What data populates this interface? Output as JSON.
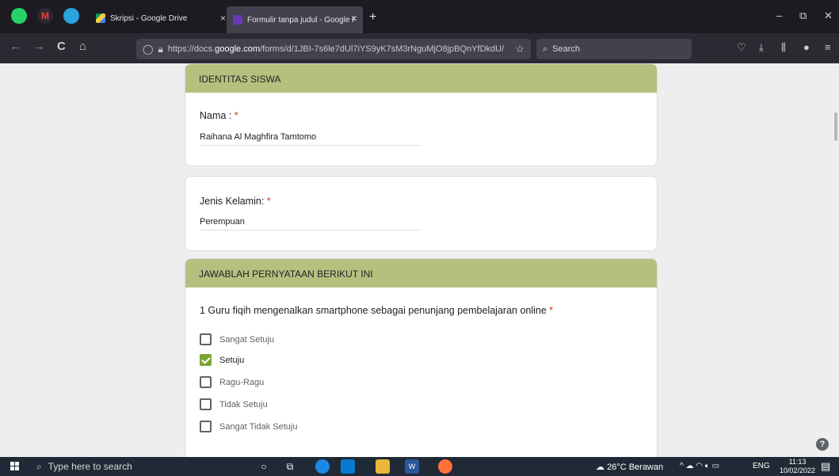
{
  "browser": {
    "tabs": [
      {
        "label": "Skripsi - Google Drive",
        "close": "×"
      },
      {
        "label": "Formulir tanpa judul - Google F",
        "close": "×"
      }
    ],
    "new_tab": "+",
    "window_controls": {
      "minimize": "–",
      "maximize": "⧉",
      "close": "✕"
    },
    "nav": {
      "back": "←",
      "forward": "→",
      "reload": "C",
      "home": "⌂"
    },
    "url_prefix": "https://docs.",
    "url_domain": "google.com",
    "url_rest": "/forms/d/1JBI-7s6le7dUl7iYS9yK7sM3rNguMjO8jpBQnYfDkdU/",
    "search_placeholder": "Search",
    "accent_colors": {
      "tab_strip": "#1c1b22",
      "toolbar": "#2b2a33",
      "section_header": "#b5c07f",
      "checkbox_checked": "#7aa52f"
    }
  },
  "form": {
    "section1": {
      "title": "IDENTITAS SISWA",
      "q_nama": {
        "label": "Nama :",
        "required": "*",
        "value": "Raihana Al Maghfira Tamtomo"
      }
    },
    "q_gender": {
      "label": "Jenis Kelamin:",
      "required": "*",
      "value": "Perempuan"
    },
    "section2": {
      "title": "JAWABLAH PERNYATAAN BERIKUT INI",
      "q1": {
        "label": "1 Guru fiqih mengenalkan smartphone sebagai penunjang pembelajaran online",
        "required": "*",
        "options": [
          "Sangat Setuju",
          "Setuju",
          "Ragu-Ragu",
          "Tidak Setuju",
          "Sangat Tidak Setuju"
        ],
        "selected": "Setuju"
      }
    },
    "help": "?"
  },
  "taskbar": {
    "search_placeholder": "Type here to search",
    "weather": "26°C  Berawan",
    "language": "ENG",
    "time": "11:13",
    "date": "10/02/2022"
  }
}
